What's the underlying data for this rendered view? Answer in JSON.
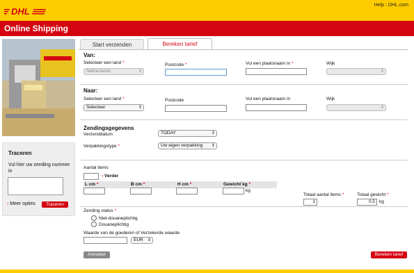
{
  "header": {
    "logo_text": "DHL",
    "help_text": "Help : DHL.com",
    "app_title": "Online Shipping"
  },
  "tracking": {
    "title": "Traceren",
    "text": "Vul hier uw zending nummer in",
    "more_options": "Meer opties",
    "button": "Traceren"
  },
  "tabs": [
    {
      "label": "Start verzenden"
    },
    {
      "label": "Bereken tarief"
    }
  ],
  "van": {
    "title": "Van:",
    "country_label": "Selecteer een land",
    "country_value": "Netherlands",
    "postcode_label": "Postcode",
    "city_label": "Vul een plaatsnaam in",
    "wijk_label": "Wijk"
  },
  "naar": {
    "title": "Naar:",
    "country_label": "Selecteer een land",
    "country_value": "Selecteer",
    "postcode_label": "Postcode",
    "city_label": "Vul een plaatsnaam in",
    "wijk_label": "Wijk"
  },
  "zending": {
    "title": "Zendingsgegevens",
    "date_label": "Verzenddatum",
    "date_value": "TODAY",
    "pack_label": "Verpakkingstype",
    "pack_value": "Uw eigen verpakking"
  },
  "items": {
    "count_label": "Aantal items",
    "verder": "Verder",
    "col_l": "L cm",
    "col_b": "B cm",
    "col_h": "H cm",
    "col_w": "Gewicht kg",
    "kg": "kg",
    "total_items_label": "Totaal aantal items",
    "total_items_value": "1",
    "total_weight_label": "Totaal gewicht",
    "total_weight_value": "0,5",
    "total_weight_unit": "kg"
  },
  "status": {
    "label": "Zending status",
    "opt1": "Niet-douaneplichtig",
    "opt2": "Douaneplichtig",
    "value_label": "Waarde van de goederen of Verzekerde waarde",
    "currency": "EUR"
  },
  "buttons": {
    "cancel": "Annuleer",
    "calculate": "Bereken tarief"
  },
  "colors": {
    "brand_yellow": "#ffcc00",
    "brand_red": "#d40511"
  }
}
